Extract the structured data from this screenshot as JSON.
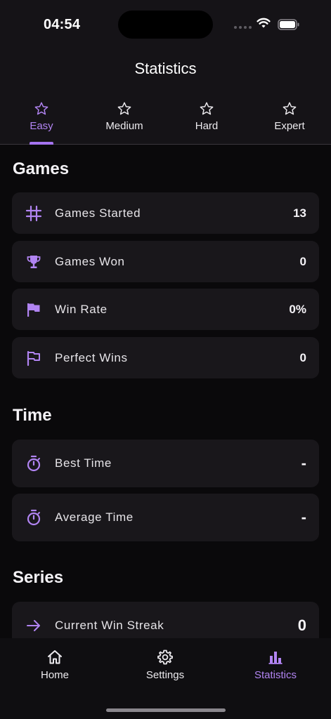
{
  "status_bar": {
    "time": "04:54"
  },
  "header": {
    "title": "Statistics"
  },
  "tabs": [
    {
      "label": "Easy",
      "active": true,
      "icon": "star-icon"
    },
    {
      "label": "Medium",
      "active": false,
      "icon": "star-icon"
    },
    {
      "label": "Hard",
      "active": false,
      "icon": "star-icon"
    },
    {
      "label": "Expert",
      "active": false,
      "icon": "star-icon"
    }
  ],
  "sections": {
    "games": {
      "title": "Games",
      "rows": [
        {
          "label": "Games Started",
          "value": "13",
          "icon": "grid-icon"
        },
        {
          "label": "Games Won",
          "value": "0",
          "icon": "trophy-icon"
        },
        {
          "label": "Win Rate",
          "value": "0%",
          "icon": "flag-icon"
        },
        {
          "label": "Perfect Wins",
          "value": "0",
          "icon": "flag-outline-icon"
        }
      ]
    },
    "time": {
      "title": "Time",
      "rows": [
        {
          "label": "Best Time",
          "value": "-",
          "icon": "stopwatch-icon"
        },
        {
          "label": "Average Time",
          "value": "-",
          "icon": "stopwatch-icon"
        }
      ]
    },
    "series": {
      "title": "Series",
      "rows": [
        {
          "label": "Current Win Streak",
          "value": "0",
          "icon": "arrow-right-icon"
        }
      ]
    }
  },
  "bottom_nav": [
    {
      "label": "Home",
      "active": false,
      "icon": "home-icon"
    },
    {
      "label": "Settings",
      "active": false,
      "icon": "gear-icon"
    },
    {
      "label": "Statistics",
      "active": true,
      "icon": "bar-chart-icon"
    }
  ],
  "colors": {
    "accent": "#b184f2",
    "background": "#0a090b",
    "card": "#19171b",
    "header": "#151317"
  }
}
